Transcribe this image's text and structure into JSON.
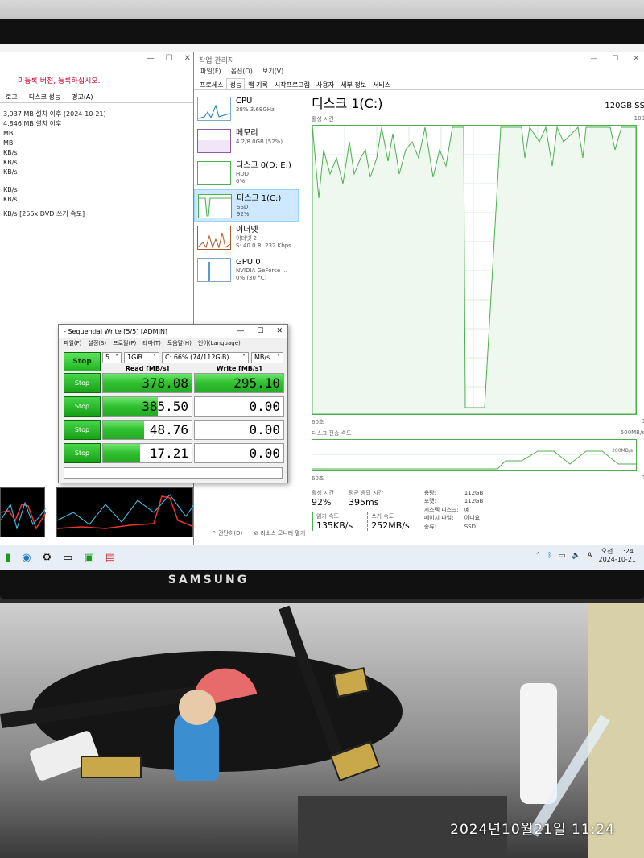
{
  "monitor": {
    "brand": "SAMSUNG"
  },
  "photo": {
    "timestamp": "2024년10월21일  11:24"
  },
  "left_window": {
    "warning": "미등록 버전, 등록하십시오.",
    "tabs": [
      "로그",
      "디스크 성능",
      "경고(A)"
    ],
    "lines": [
      "3,937 MB 설치 이후 (2024-10-21)",
      "4,846 MB 설치 이후",
      "MB",
      "MB",
      "KB/s",
      "KB/s",
      "KB/s",
      "KB/s",
      "KB/s",
      "KB/s [255x DVD 쓰기 속도]"
    ]
  },
  "taskmgr": {
    "title": "작업 관리자",
    "menu": [
      "파일(F)",
      "옵션(O)",
      "보기(V)"
    ],
    "tabs": [
      "프로세스",
      "성능",
      "앱 기록",
      "시작프로그램",
      "사용자",
      "세부 정보",
      "서비스"
    ],
    "active_tab": "성능",
    "resources": [
      {
        "name": "CPU",
        "line1": "28% 3.69GHz",
        "line2": ""
      },
      {
        "name": "메모리",
        "line1": "4.2/8.0GB (52%)",
        "line2": ""
      },
      {
        "name": "디스크 0(D: E:)",
        "line1": "HDD",
        "line2": "0%"
      },
      {
        "name": "디스크 1(C:)",
        "line1": "SSD",
        "line2": "92%"
      },
      {
        "name": "이더넷",
        "line1": "이더넷 2",
        "line2": "S: 40.0  R: 232 Kbps"
      },
      {
        "name": "GPU 0",
        "line1": "NVIDIA GeForce ...",
        "line2": "0% (30 °C)"
      }
    ],
    "detail": {
      "title": "디스크 1(C:)",
      "model": "120GB SS",
      "activity_label": "활성 시간",
      "activity_max": "100",
      "time_label": "60초",
      "time_end": "0",
      "transfer_label": "디스크 전송 속도",
      "transfer_max": "500MB/s",
      "transfer_mid": "200MB/s",
      "active_time_label": "활성 시간",
      "active_time_value": "92%",
      "response_label": "평균 응답 시간",
      "response_value": "395ms",
      "read_label": "읽기 속도",
      "read_value": "135KB/s",
      "write_label": "쓰기 속도",
      "write_value": "252MB/s",
      "props": [
        [
          "용량:",
          "112GB"
        ],
        [
          "포맷:",
          "112GB"
        ],
        [
          "시스템 디스크:",
          "예"
        ],
        [
          "페이지 파일:",
          "아니요"
        ],
        [
          "종류:",
          "SSD"
        ]
      ]
    },
    "footer": [
      "간단히(D)",
      "리소스 모니터 열기"
    ]
  },
  "cdm": {
    "title": "- Sequential Write [5/5] [ADMIN]",
    "menu": [
      "파일(F)",
      "설정(S)",
      "프로필(P)",
      "테마(T)",
      "도움말(H)",
      "언어(Language)"
    ],
    "main_button": "Stop",
    "count": "5",
    "size": "1GiB",
    "drive": "C: 66% (74/112GiB)",
    "unit": "MB/s",
    "read_header": "Read [MB/s]",
    "write_header": "Write [MB/s]",
    "rows": [
      {
        "button": "Stop",
        "read": "378.08",
        "read_fill": 1.0,
        "write": "295.10",
        "write_fill": 1.0
      },
      {
        "button": "Stop",
        "read": "385.50",
        "read_fill": 0.62,
        "write": "0.00",
        "write_fill": 0
      },
      {
        "button": "Stop",
        "read": "48.76",
        "read_fill": 0.46,
        "write": "0.00",
        "write_fill": 0
      },
      {
        "button": "Stop",
        "read": "17.21",
        "read_fill": 0.42,
        "write": "0.00",
        "write_fill": 0
      }
    ]
  },
  "taskbar": {
    "time": "오전 11:24",
    "date": "2024-10-21",
    "lang": "A"
  }
}
